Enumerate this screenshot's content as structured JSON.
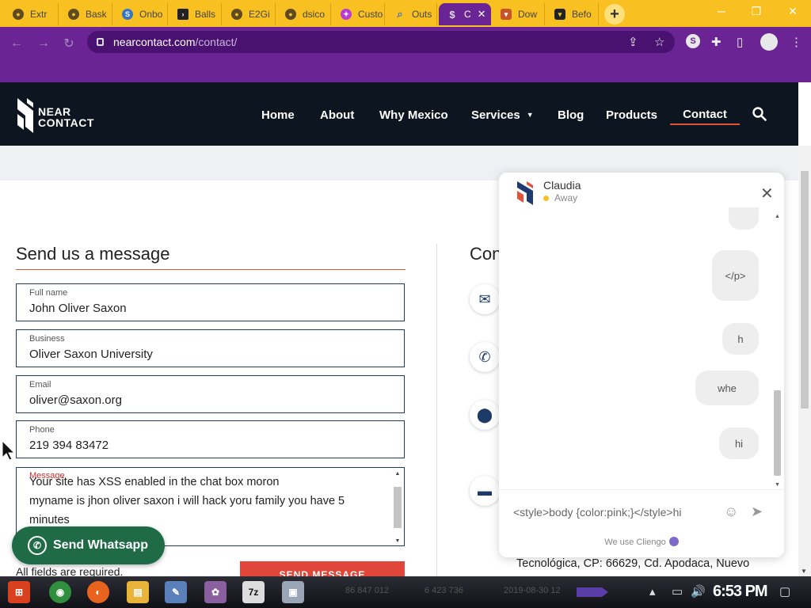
{
  "browser": {
    "tabs": [
      {
        "title": "Extr",
        "icon": "chrome-icon"
      },
      {
        "title": "Bask",
        "icon": "chrome-icon"
      },
      {
        "title": "Onbo",
        "icon": "s-icon"
      },
      {
        "title": "Balls",
        "icon": "terminal-icon"
      },
      {
        "title": "E2Gi",
        "icon": "chrome-icon"
      },
      {
        "title": "dsico",
        "icon": "chrome-icon"
      },
      {
        "title": "Custo",
        "icon": "puzzle-icon"
      },
      {
        "title": "Outs",
        "icon": "search-icon"
      },
      {
        "title": "C",
        "icon": "nearcontact-icon",
        "active": true
      },
      {
        "title": "Dow",
        "icon": "shield-icon"
      },
      {
        "title": "Befo",
        "icon": "shield-icon"
      }
    ],
    "url_domain": "nearcontact.com",
    "url_path": "/contact/",
    "accent": "#6a2494",
    "tabstrip_color": "#f8c021"
  },
  "site": {
    "logo_line1": "NEAR",
    "logo_line2": "CONTACT",
    "nav": [
      "Home",
      "About",
      "Why Mexico",
      "Services",
      "Blog",
      "Products",
      "Contact"
    ],
    "active_nav": "Contact"
  },
  "form": {
    "title": "Send us a message",
    "full_name_label": "Full name",
    "full_name_value": "John Oliver Saxon",
    "business_label": "Business",
    "business_value": "Oliver Saxon University",
    "email_label": "Email",
    "email_value": "oliver@saxon.org",
    "phone_label": "Phone",
    "phone_value": "219 394 83472",
    "message_label": "Message",
    "message_value": "Your site has XSS enabled in the chat box moron\nmyname is jhon oliver saxon i will hack yoru family you have 5 minutes",
    "required_note": "All fields are required.",
    "send_button": "SEND MESSAGE",
    "whatsapp_button": "Send Whatsapp"
  },
  "contact": {
    "title": "Con",
    "address_line": "Tecnológica, CP: 66629, Cd. Apodaca, Nuevo"
  },
  "chat": {
    "agent_name": "Claudia",
    "agent_status": "Away",
    "messages": [
      "</p>",
      "h",
      "whe",
      "hi"
    ],
    "input_value": "<style>body {color:pink;}</style>hi",
    "footer": "We use Cliengo"
  },
  "taskbar": {
    "clock": "6:53 PM",
    "ghost_numbers": [
      "86 847 012",
      "6 423 736",
      "2019-08-30 12"
    ]
  }
}
